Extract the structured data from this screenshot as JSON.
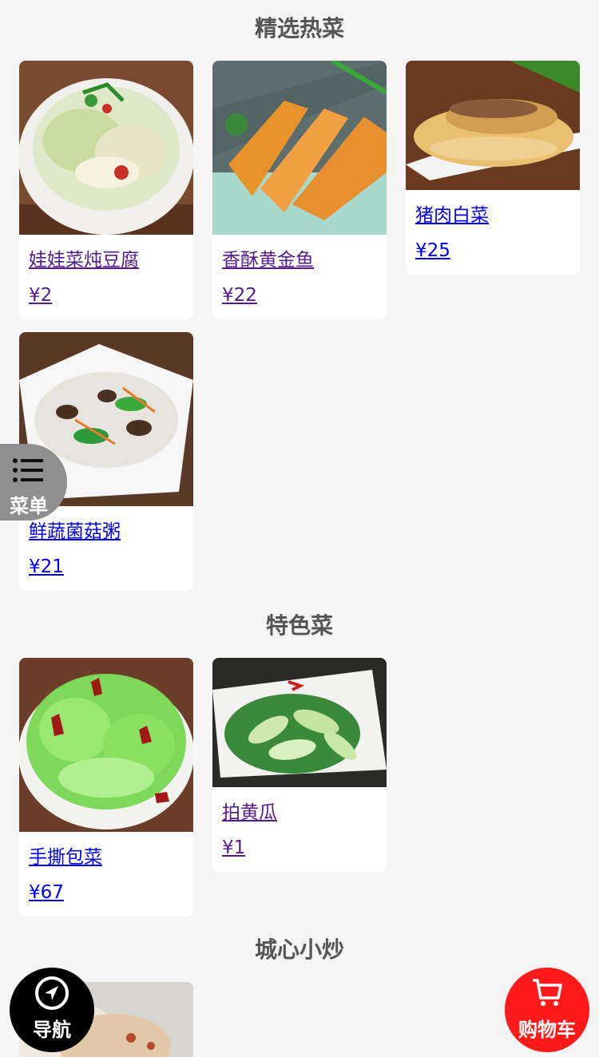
{
  "sections": [
    {
      "title": "精选热菜"
    },
    {
      "title": "特色菜"
    },
    {
      "title": "城心小炒"
    }
  ],
  "dishes": [
    {
      "name": "娃娃菜炖豆腐",
      "price": "¥2"
    },
    {
      "name": "香酥黄金鱼",
      "price": "¥22"
    },
    {
      "name": "猪肉白菜",
      "price": "¥25"
    },
    {
      "name": "鲜蔬菌菇粥",
      "price": "¥21"
    },
    {
      "name": "手撕包菜",
      "price": "¥67"
    },
    {
      "name": "拍黄瓜",
      "price": "¥1"
    }
  ],
  "floating": {
    "menu_label": "菜单",
    "nav_label": "导航",
    "cart_label": "购物车"
  },
  "icons": {
    "menu": "list-icon",
    "nav": "navigation-arrow-icon",
    "cart": "cart-icon"
  },
  "colors": {
    "background": "#f5f5f5",
    "section_title": "#555555",
    "link_visited": "#551a8b",
    "link_unvisited": "#0000ee",
    "menu_tab": "#8f8f8f",
    "nav_button": "#000000",
    "cart_button": "#ff1a1a"
  }
}
